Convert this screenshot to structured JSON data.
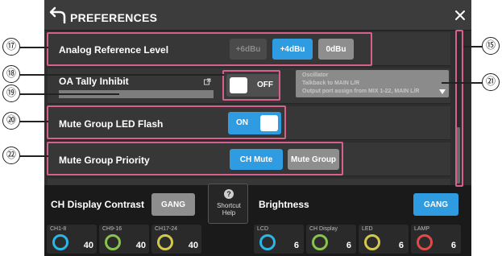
{
  "header": {
    "title": "PREFERENCES",
    "back_icon": "back-arrow-icon",
    "close_icon": "close-icon"
  },
  "rows": {
    "analog_ref": {
      "label": "Analog Reference Level",
      "options": [
        "+6dBu",
        "+4dBu",
        "0dBu"
      ],
      "selected": "+4dBu"
    },
    "oa_tally": {
      "label": "OA Tally Inhibit",
      "toggle": "OFF",
      "dropdown_lines": [
        "Oscillator",
        "Talkback to MAIN L/R",
        "Output port assign from MIX 1-22, MAIN L/R"
      ]
    },
    "mute_led": {
      "label": "Mute Group LED Flash",
      "toggle": "ON"
    },
    "mute_priority": {
      "label": "Mute Group Priority",
      "options": [
        "CH Mute",
        "Mute Group"
      ],
      "selected": "CH Mute"
    }
  },
  "bottom": {
    "ch_display_contrast": {
      "label": "CH Display Contrast",
      "gang": "GANG",
      "knobs": [
        {
          "label": "CH1-8",
          "value": "40"
        },
        {
          "label": "CH9-16",
          "value": "40"
        },
        {
          "label": "CH17-24",
          "value": "40"
        }
      ]
    },
    "shortcut": {
      "line1": "Shortcut",
      "line2": "Help"
    },
    "brightness": {
      "label": "Brightness",
      "gang": "GANG",
      "knobs": [
        {
          "label": "LCD",
          "value": "6"
        },
        {
          "label": "CH Display",
          "value": "6"
        },
        {
          "label": "LED",
          "value": "6"
        },
        {
          "label": "LAMP",
          "value": "6"
        }
      ]
    }
  },
  "callouts": {
    "c15": "⑮",
    "c17": "⑰",
    "c18": "⑱",
    "c19": "⑲",
    "c20": "⑳",
    "c21": "㉑",
    "c22": "㉒"
  },
  "colors": {
    "accent": "#2f9be0",
    "callout_box": "#d7608f",
    "knob_cyan": "#29b6e8",
    "knob_green": "#8bc34a",
    "knob_yellow": "#d4c84a",
    "knob_red": "#e04a4a"
  }
}
